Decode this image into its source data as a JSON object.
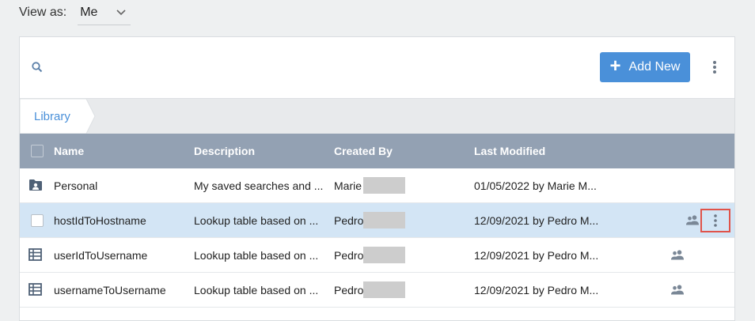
{
  "view_as": {
    "label": "View as:",
    "value": "Me"
  },
  "toolbar": {
    "add_new_label": "Add New"
  },
  "breadcrumb": {
    "items": [
      "Library"
    ]
  },
  "table": {
    "headers": {
      "name": "Name",
      "description": "Description",
      "created_by": "Created By",
      "last_modified": "Last Modified"
    },
    "rows": [
      {
        "type": "folder",
        "name": "Personal",
        "description": "My saved searches and ...",
        "created_by": "Marie",
        "last_modified": "01/05/2022 by Marie M...",
        "shared": false,
        "selected": false
      },
      {
        "type": "lookup-table",
        "name": "hostIdToHostname",
        "description": "Lookup table based on ...",
        "created_by": "Pedro",
        "last_modified": "12/09/2021 by Pedro M...",
        "shared": true,
        "selected": true
      },
      {
        "type": "lookup-table",
        "name": "userIdToUsername",
        "description": "Lookup table based on ...",
        "created_by": "Pedro",
        "last_modified": "12/09/2021 by Pedro M...",
        "shared": true,
        "selected": false
      },
      {
        "type": "lookup-table",
        "name": "usernameToUsername",
        "description": "Lookup table based on ...",
        "created_by": "Pedro",
        "last_modified": "12/09/2021 by Pedro M...",
        "shared": true,
        "selected": false
      }
    ]
  },
  "icons": {
    "search": "search-icon",
    "chevron": "chevron-down-icon",
    "plus": "plus-icon",
    "kebab": "more-vertical-icon",
    "folder": "user-folder-icon",
    "table": "table-icon",
    "shared": "shared-users-icon"
  },
  "colors": {
    "accent": "#4a90d9",
    "header_bg": "#93a1b3",
    "selected_row": "#d3e5f5",
    "highlight_border": "#e0534a"
  }
}
